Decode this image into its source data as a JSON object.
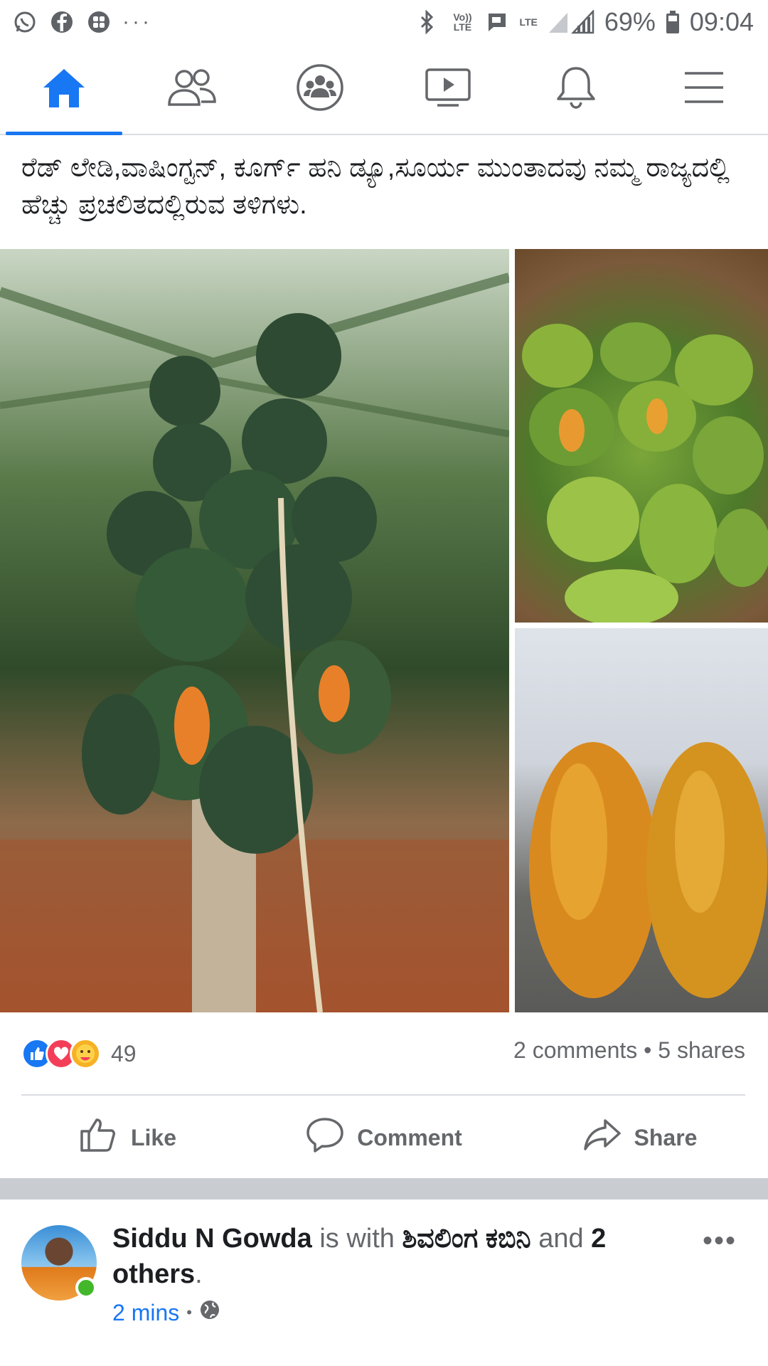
{
  "status_bar": {
    "battery": "69%",
    "time": "09:04",
    "volte_label": "Vo)) LTE",
    "lte_label": "LTE",
    "notification_icons": [
      "whatsapp-icon",
      "facebook-icon",
      "app-grid-icon"
    ],
    "overflow": "···"
  },
  "nav": {
    "tabs": [
      {
        "name": "home",
        "icon": "home-icon",
        "active": true
      },
      {
        "name": "friends",
        "icon": "friends-icon",
        "active": false
      },
      {
        "name": "groups",
        "icon": "groups-icon",
        "active": false
      },
      {
        "name": "watch",
        "icon": "watch-icon",
        "active": false
      },
      {
        "name": "notifications",
        "icon": "bell-icon",
        "active": false
      },
      {
        "name": "menu",
        "icon": "menu-icon",
        "active": false
      }
    ],
    "accent_color": "#1877f2"
  },
  "post": {
    "text": "ರೆಡ್ ಲೇಡಿ,ವಾಷಿಂಗ್ಟನ್, ಕೂರ್ಗ್ ಹನಿ ಡ್ಯೂ,ಸೂರ್ಯ ಮುಂತಾದವು ನಮ್ಮ ರಾಜ್ಯದಲ್ಲಿ ಹೆಚ್ಚು ಪ್ರಚಲಿತದಲ್ಲಿರುವ ತಳಿಗಳು.",
    "reaction_count": "49",
    "comments_shares": "2 comments • 5 shares",
    "actions": {
      "like": "Like",
      "comment": "Comment",
      "share": "Share"
    }
  },
  "next_post": {
    "author": "Siddu N Gowda",
    "is_with": "is with",
    "tagged": "ಶಿವಲಿಂಗ ಕಬಿನಿ",
    "and": "and",
    "others": "2 others",
    "period": ".",
    "time": "2 mins",
    "dot": "•",
    "privacy_icon": "globe-icon",
    "more": "•••",
    "text_preview": ""
  }
}
